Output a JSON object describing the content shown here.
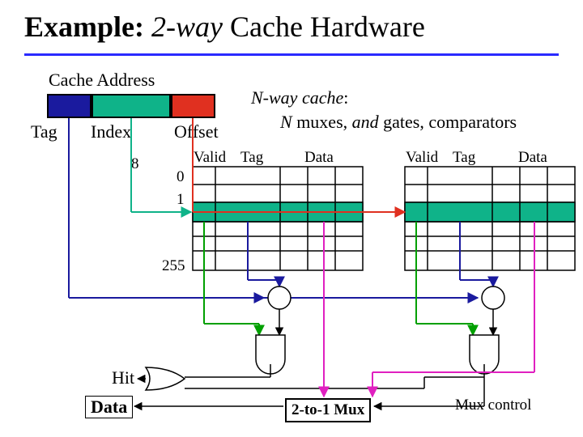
{
  "title": {
    "lead": "Example:",
    "mid": "2-way",
    "tail": "Cache Hardware"
  },
  "addr": {
    "label": "Cache Address",
    "tag": "Tag",
    "index": "Index",
    "offset": "Offset"
  },
  "caption": {
    "l1a": "N-way cache",
    "l1b": ":",
    "l2a": "N",
    "l2b": " muxes, ",
    "l2c": "and",
    "l2d": " gates, comparators"
  },
  "rows": {
    "r0": "0",
    "r1": "1",
    "r8": "8",
    "r255": "255"
  },
  "cols": {
    "valid": "Valid",
    "tag": "Tag",
    "data": "Data"
  },
  "out": {
    "hit": "Hit",
    "data": "Data",
    "mux": "2-to-1 Mux",
    "muxctl": "Mux control"
  },
  "sym": {
    "eq": "="
  }
}
